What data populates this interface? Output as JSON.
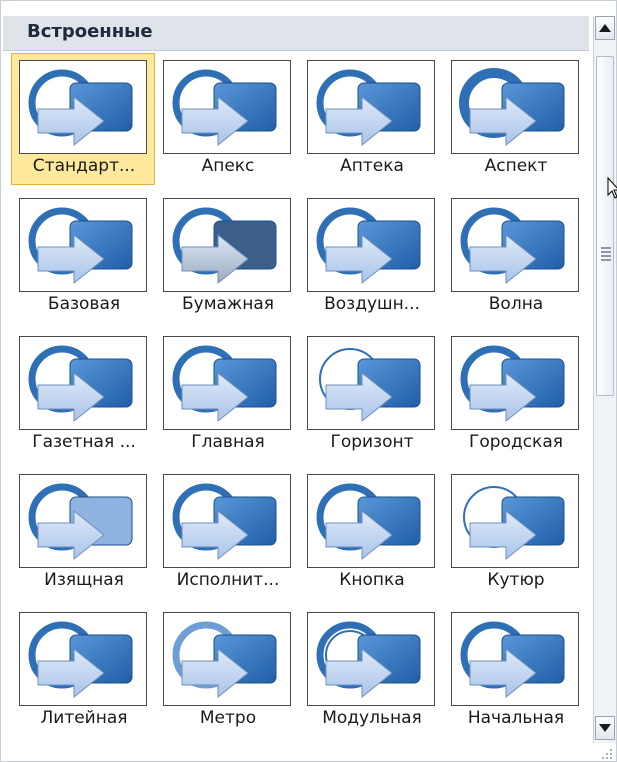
{
  "gallery": {
    "header": "Встроенные",
    "selected_index": 0,
    "items": [
      {
        "label": "Стандарт...",
        "style": "standard"
      },
      {
        "label": "Апекс",
        "style": "apex"
      },
      {
        "label": "Аптека",
        "style": "standard"
      },
      {
        "label": "Аспект",
        "style": "bold"
      },
      {
        "label": "Базовая",
        "style": "standard"
      },
      {
        "label": "Бумажная",
        "style": "paper"
      },
      {
        "label": "Воздушн...",
        "style": "soft"
      },
      {
        "label": "Волна",
        "style": "standard"
      },
      {
        "label": "Газетная ...",
        "style": "standard"
      },
      {
        "label": "Главная",
        "style": "standard"
      },
      {
        "label": "Горизонт",
        "style": "thin"
      },
      {
        "label": "Городская",
        "style": "standard"
      },
      {
        "label": "Изящная",
        "style": "glass"
      },
      {
        "label": "Исполнит...",
        "style": "standard"
      },
      {
        "label": "Кнопка",
        "style": "standard"
      },
      {
        "label": "Кутюр",
        "style": "thin"
      },
      {
        "label": "Литейная",
        "style": "standard"
      },
      {
        "label": "Метро",
        "style": "glow"
      },
      {
        "label": "Модульная",
        "style": "double"
      },
      {
        "label": "Начальная",
        "style": "standard"
      }
    ]
  },
  "colors": {
    "ring": "#2f6fb5",
    "box_dark": "#1f5fa8",
    "box_light": "#5a97d9",
    "arrow": "#a9c4ea",
    "selected_bg": "#fde89c"
  },
  "icons": {
    "scroll_up": "triangle-up-icon",
    "scroll_down": "triangle-down-icon"
  }
}
